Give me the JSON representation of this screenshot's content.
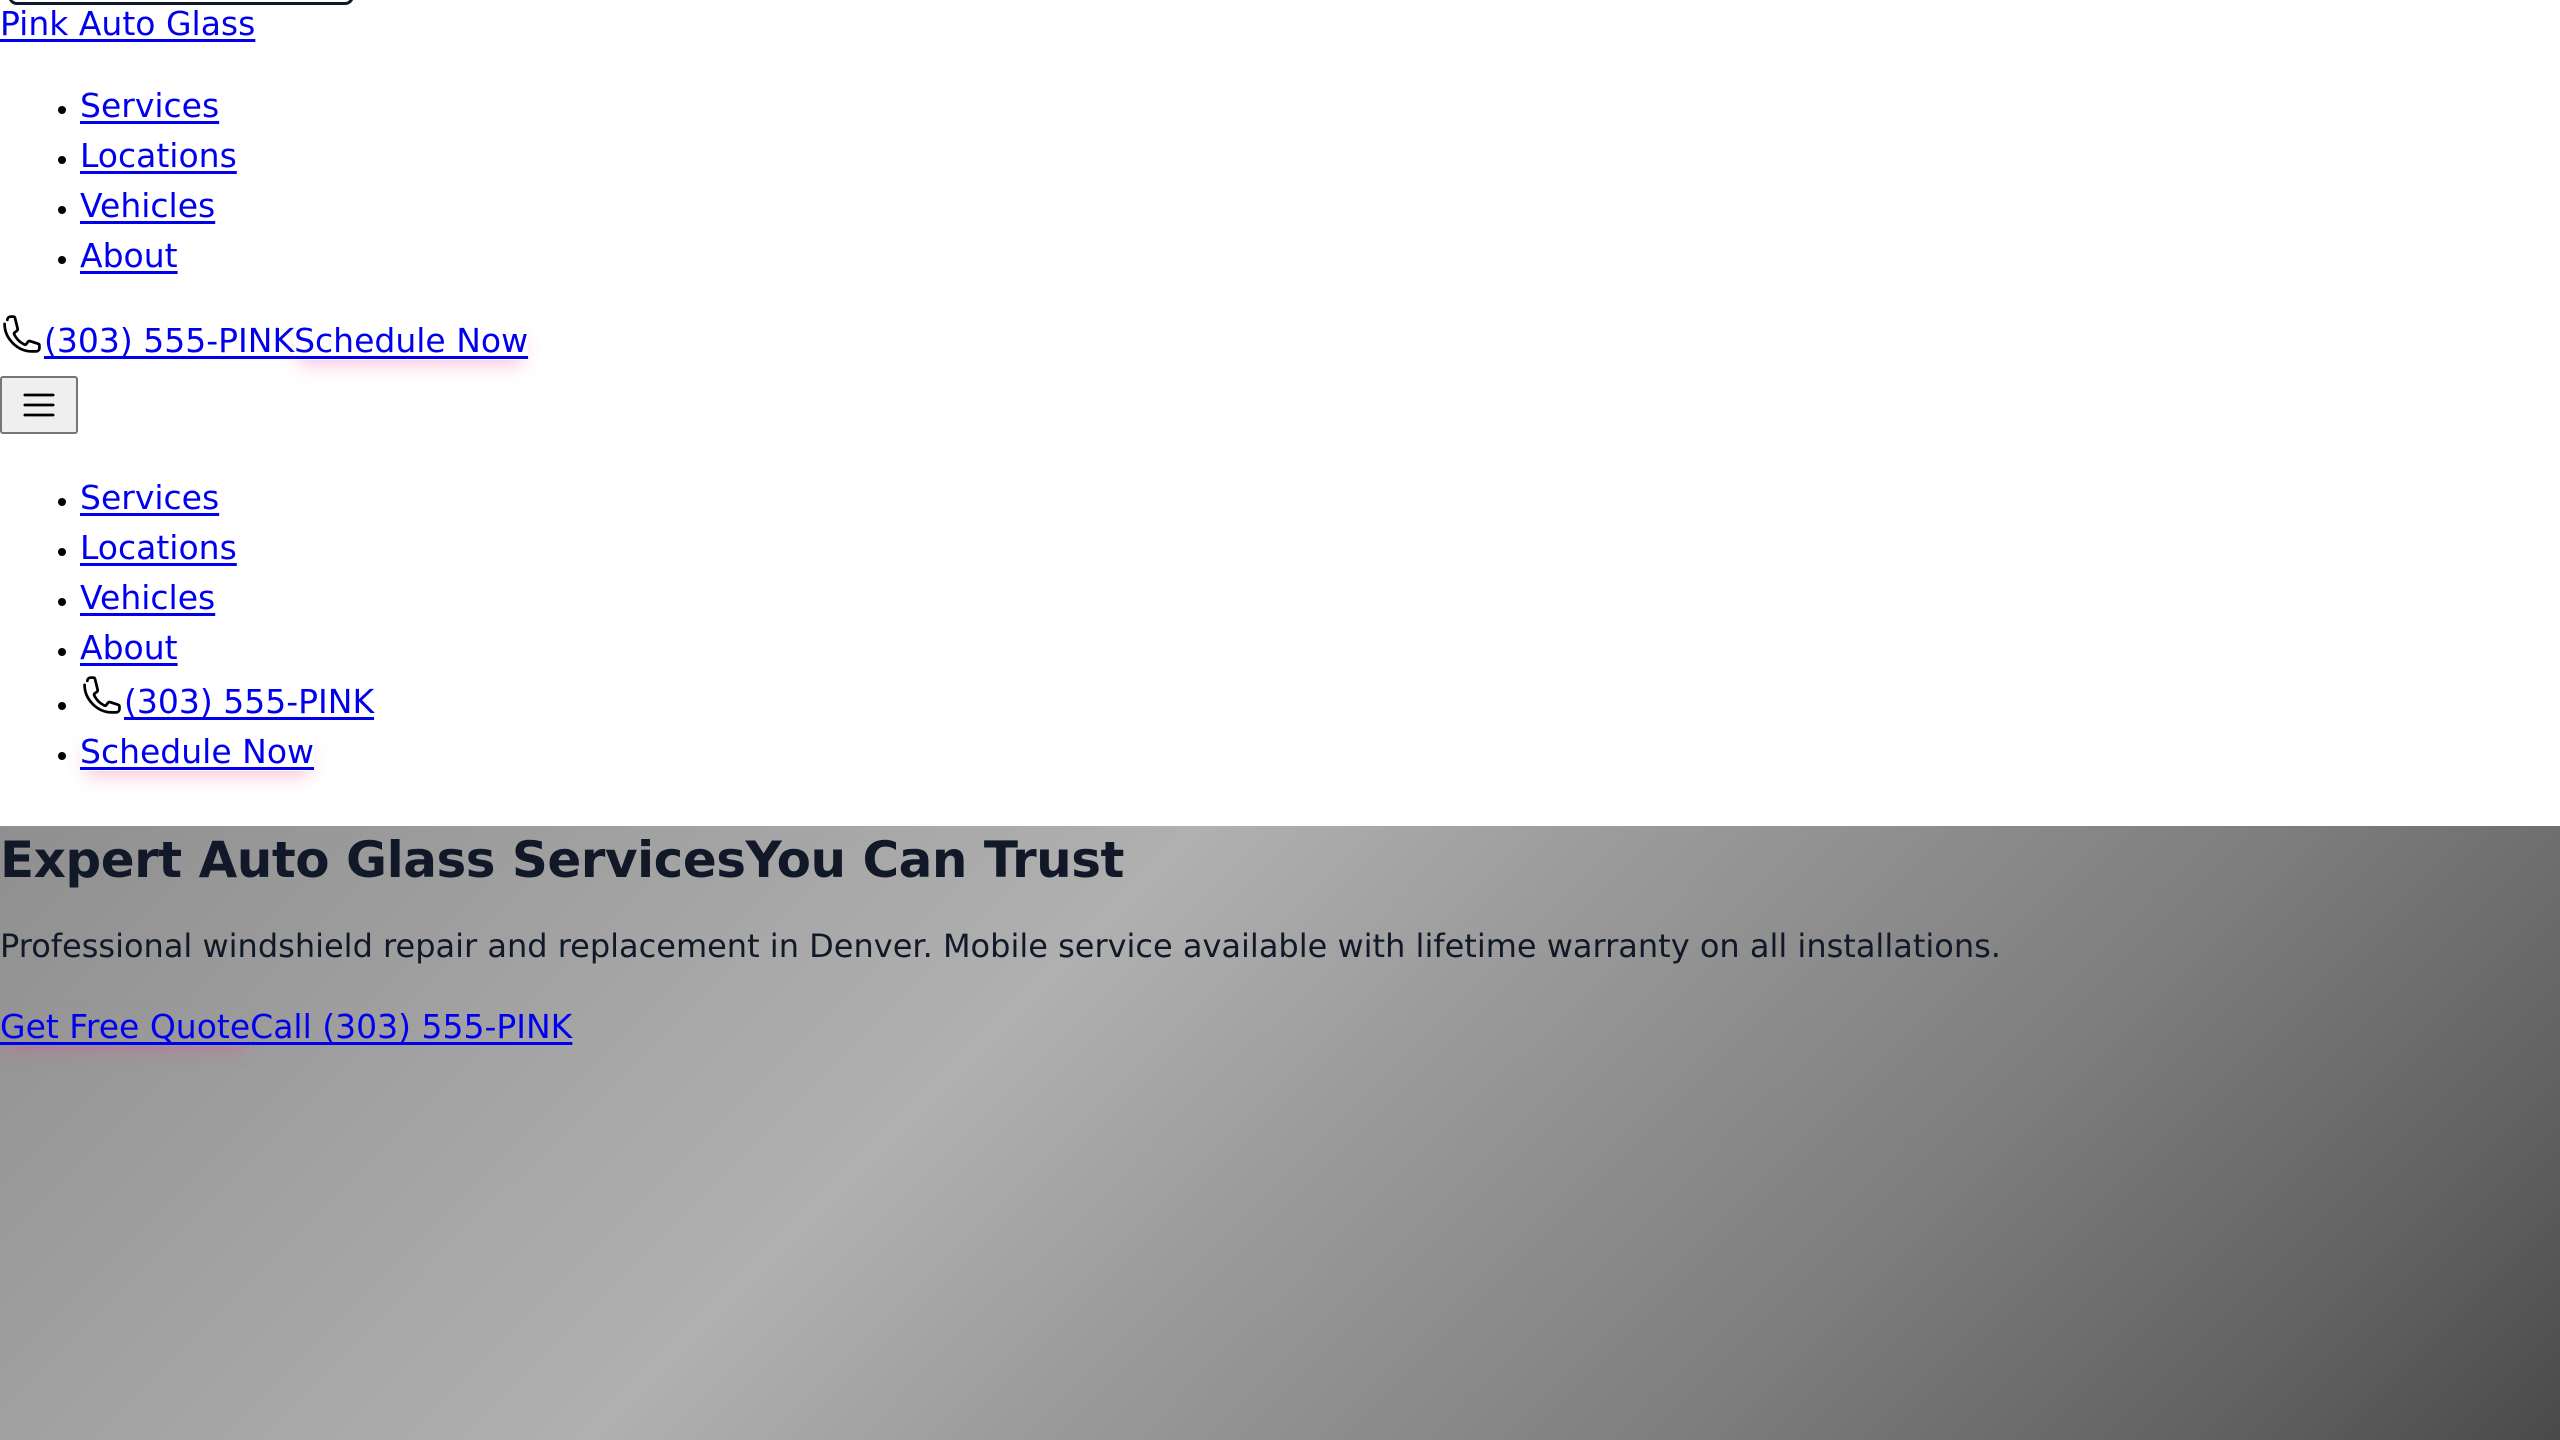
{
  "header": {
    "brand": "Pink Auto Glass",
    "nav": [
      "Services",
      "Locations",
      "Vehicles",
      "About"
    ],
    "phone": "(303) 555-PINK",
    "schedule": "Schedule Now",
    "menu_icon": "hamburger-menu-icon",
    "phone_icon": "phone-icon"
  },
  "mobile_menu": {
    "items": [
      "Services",
      "Locations",
      "Vehicles",
      "About"
    ],
    "phone": "(303) 555-PINK",
    "schedule": "Schedule Now"
  },
  "hero": {
    "title_part1": "Expert Auto Glass Services",
    "title_part2": "You Can Trust",
    "subtitle": "Professional windshield repair and replacement in Denver. Mobile service available with lifetime warranty on all installations.",
    "primary_cta": "Get Free Quote",
    "secondary_cta": "Call (303) 555-PINK"
  },
  "colors": {
    "link": "#0000ee",
    "text": "#0f172a",
    "accent_glow": "#ec4899"
  }
}
